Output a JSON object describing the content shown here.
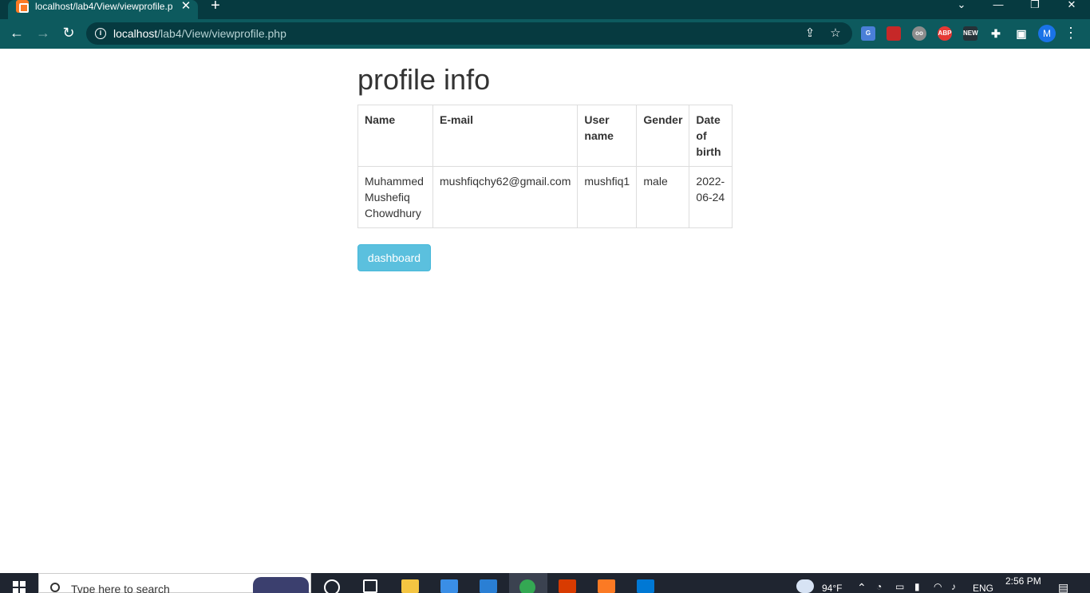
{
  "browser": {
    "tab_title": "localhost/lab4/View/viewprofile.p",
    "tab_close": "✕",
    "new_tab": "+",
    "url_host": "localhost",
    "url_path": "/lab4/View/viewprofile.php",
    "profile_initial": "M"
  },
  "page": {
    "title": "profile info",
    "table": {
      "headers": [
        "Name",
        "E-mail",
        "User name",
        "Gender",
        "Date of birth"
      ],
      "row": [
        "Muhammed Mushefiq Chowdhury",
        "mushfiqchy62@gmail.com",
        "mushfiq1",
        "male",
        "2022-06-24"
      ]
    },
    "dashboard_label": "dashboard"
  },
  "taskbar": {
    "search_placeholder": "Type here to search",
    "temperature": "94°F",
    "language": "ENG",
    "time": "2:56 PM"
  },
  "colors": {
    "chrome_dark": "#063a40",
    "chrome_toolbar": "#0d5a5e",
    "button_info": "#5bc0de",
    "taskbar": "#1f2530"
  }
}
